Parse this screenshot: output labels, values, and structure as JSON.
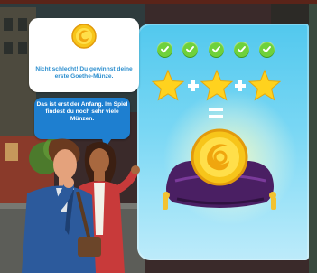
{
  "dialog": {
    "top_bubble": {
      "text": "Nicht schlecht! Du gewinnst deine erste Goethe-Münze.",
      "icon": "goethe-coin-icon"
    },
    "bottom_bubble": {
      "text": "Das ist erst der Anfang. Im Spiel findest du noch sehr viele Münzen."
    }
  },
  "reward_panel": {
    "checks": [
      {
        "icon": "check-icon",
        "done": true
      },
      {
        "icon": "check-icon",
        "done": true
      },
      {
        "icon": "check-icon",
        "done": true
      },
      {
        "icon": "check-icon",
        "done": true
      },
      {
        "icon": "check-icon",
        "done": true
      }
    ],
    "stars_count": 3,
    "reward_icon": "goethe-coin-on-pillow-icon"
  },
  "colors": {
    "panel_top": "#52c8ee",
    "panel_bottom": "#bdebfa",
    "check_green": "#6fd13b",
    "star_yellow": "#ffd21e",
    "bubble_blue": "#1e7fd0",
    "bubble_text_blue": "#2d8fcf",
    "coin_gold": "#f7c51a",
    "pillow_purple": "#4a1f63"
  }
}
